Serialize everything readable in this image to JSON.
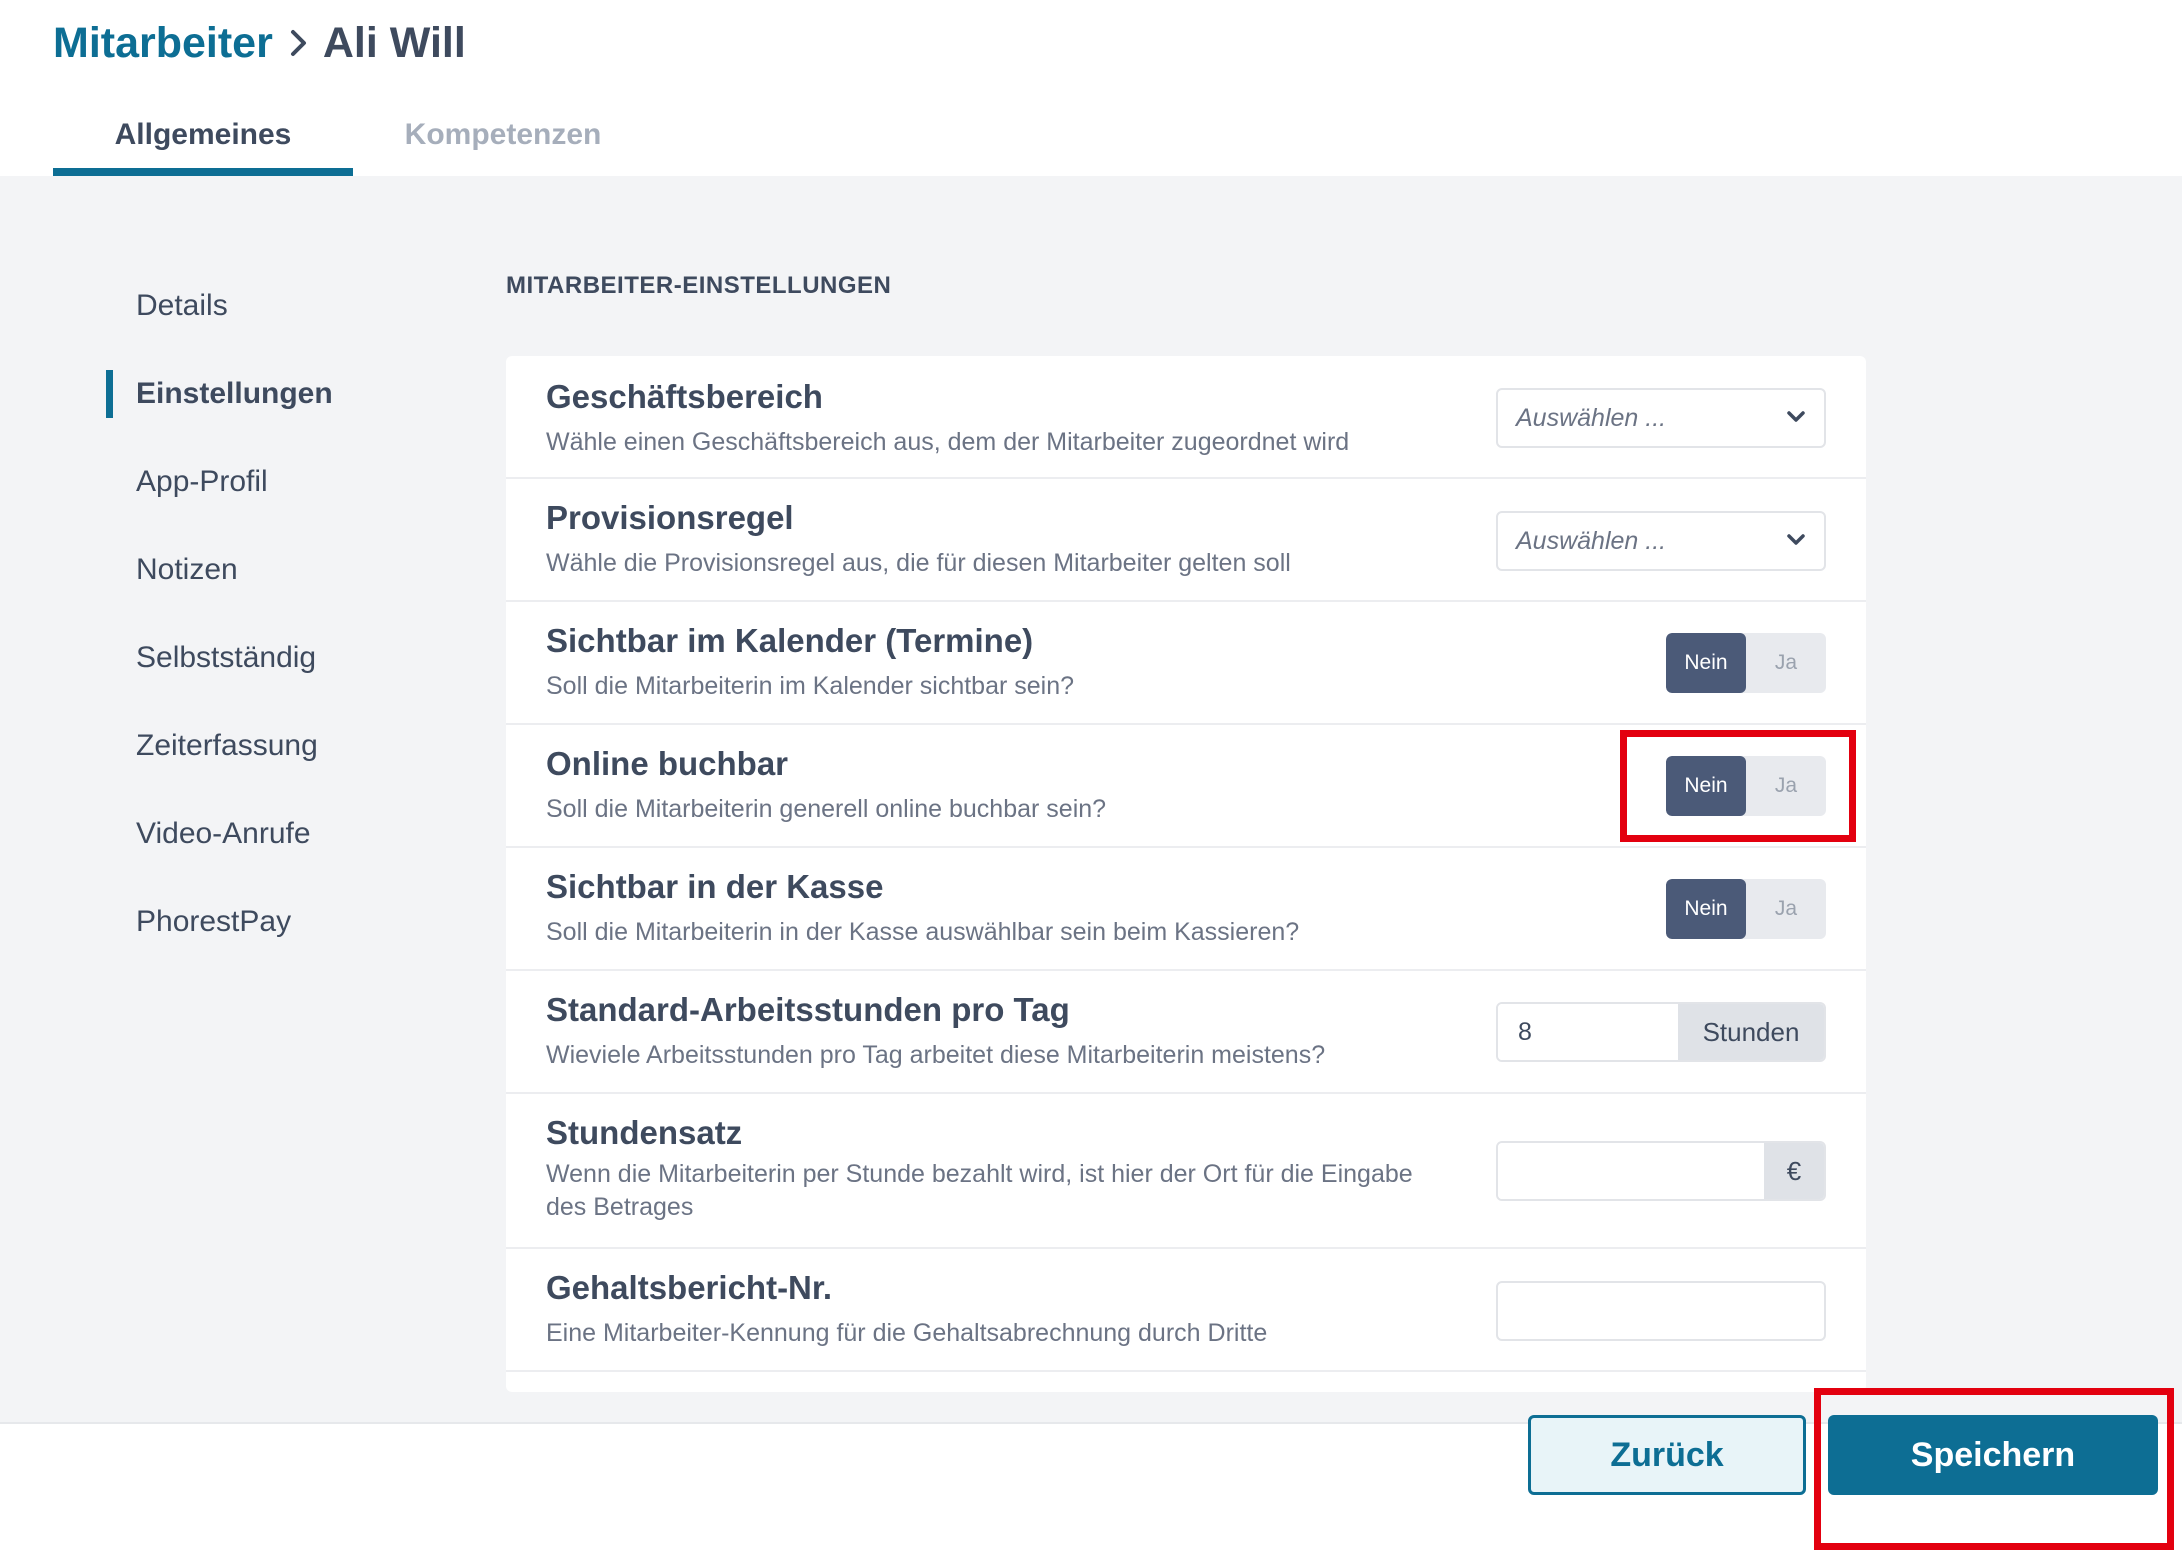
{
  "header": {
    "breadcrumb_parent": "Mitarbeiter",
    "breadcrumb_current": "Ali Will",
    "tabs": [
      {
        "label": "Allgemeines",
        "active": true
      },
      {
        "label": "Kompetenzen",
        "active": false
      }
    ]
  },
  "sidebar": {
    "items": [
      {
        "label": "Details",
        "active": false
      },
      {
        "label": "Einstellungen",
        "active": true
      },
      {
        "label": "App-Profil",
        "active": false
      },
      {
        "label": "Notizen",
        "active": false
      },
      {
        "label": "Selbstständig",
        "active": false
      },
      {
        "label": "Zeiterfassung",
        "active": false
      },
      {
        "label": "Video-Anrufe",
        "active": false
      },
      {
        "label": "PhorestPay",
        "active": false
      }
    ]
  },
  "main": {
    "section_title": "MITARBEITER-EINSTELLUNGEN",
    "settings": {
      "business_area": {
        "title": "Geschäftsbereich",
        "description": "Wähle einen Geschäftsbereich aus, dem der Mitarbeiter zugeordnet wird",
        "placeholder": "Auswählen ..."
      },
      "commission_rule": {
        "title": "Provisionsregel",
        "description": "Wähle die Provisionsregel aus, die für diesen Mitarbeiter gelten soll",
        "placeholder": "Auswählen ..."
      },
      "calendar_visible": {
        "title": "Sichtbar im Kalender (Termine)",
        "description": "Soll die Mitarbeiterin im Kalender sichtbar sein?",
        "no_label": "Nein",
        "yes_label": "Ja",
        "selected": "Nein"
      },
      "online_bookable": {
        "title": "Online buchbar",
        "description": "Soll die Mitarbeiterin generell online buchbar sein?",
        "no_label": "Nein",
        "yes_label": "Ja",
        "selected": "Nein"
      },
      "till_visible": {
        "title": "Sichtbar in der Kasse",
        "description": "Soll die Mitarbeiterin in der Kasse auswählbar sein beim Kassieren?",
        "no_label": "Nein",
        "yes_label": "Ja",
        "selected": "Nein"
      },
      "default_hours": {
        "title": "Standard-Arbeitsstunden pro Tag",
        "description": "Wieviele Arbeitsstunden pro Tag arbeitet diese Mitarbeiterin meistens?",
        "value": "8",
        "unit": "Stunden"
      },
      "hourly_rate": {
        "title": "Stundensatz",
        "description": "Wenn die Mitarbeiterin per Stunde bezahlt wird, ist hier der Ort für die Eingabe des Betrages",
        "value": "",
        "unit": "€"
      },
      "payroll_id": {
        "title": "Gehaltsbericht-Nr.",
        "description": "Eine Mitarbeiter-Kennung für die Gehaltsabrechnung durch Dritte",
        "value": ""
      }
    }
  },
  "footer": {
    "back_label": "Zurück",
    "save_label": "Speichern"
  },
  "colors": {
    "accent": "#0d6e94",
    "toggle_active": "#4b5a78",
    "highlight": "#e3000f"
  }
}
